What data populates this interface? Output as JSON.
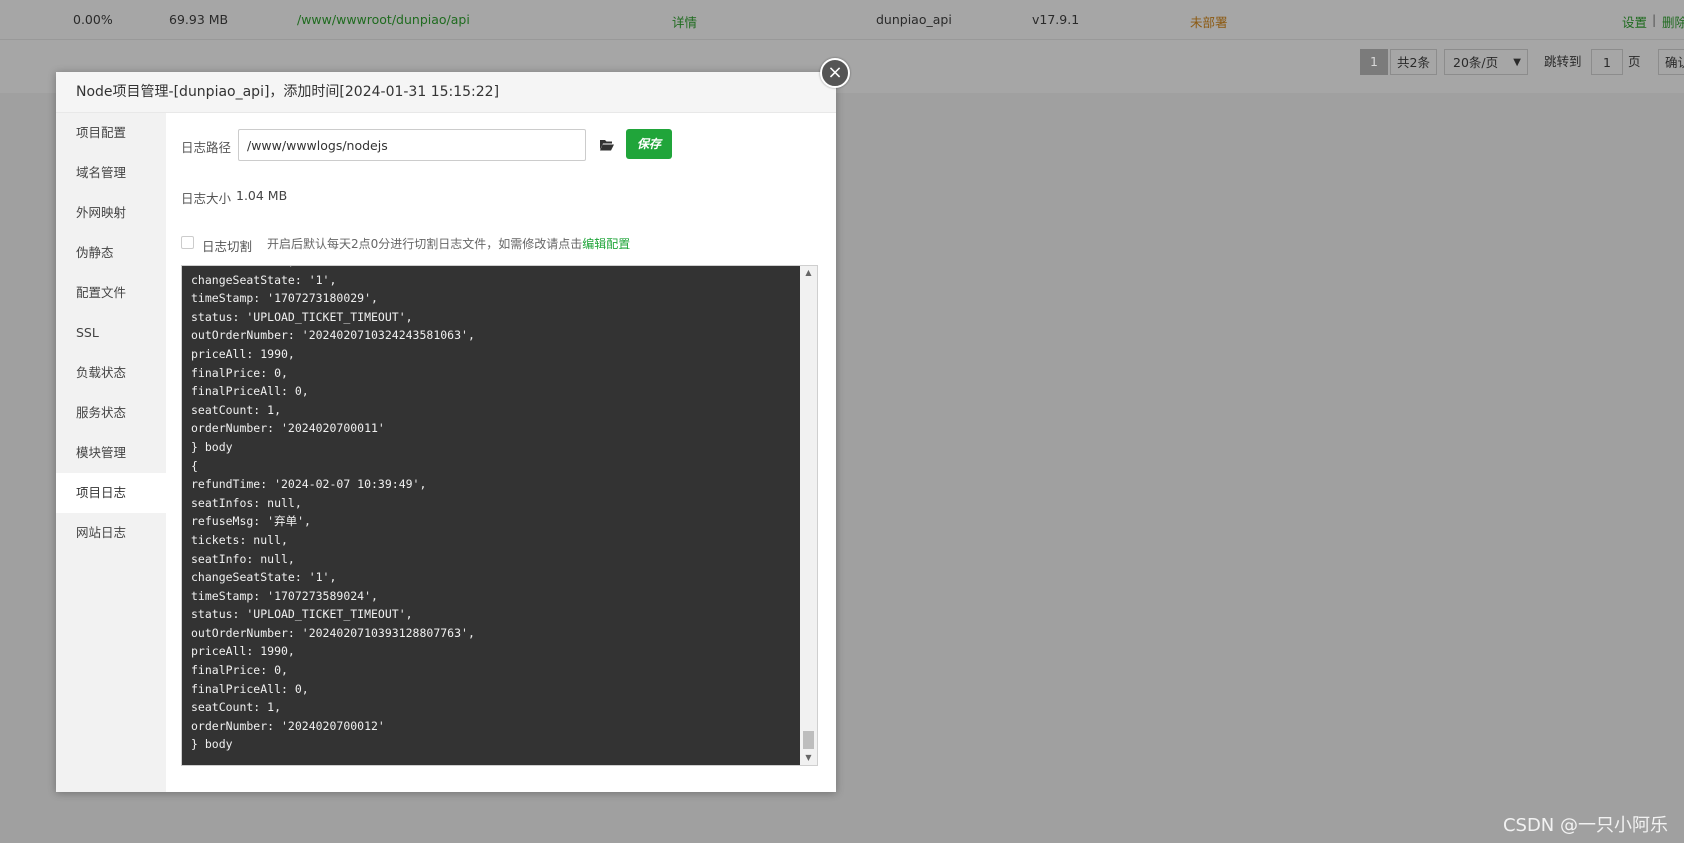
{
  "background": {
    "row": {
      "cpu": "0.00%",
      "memory": "69.93 MB",
      "path": "/www/wwwroot/dunpiao/api",
      "details": "详情",
      "name": "dunpiao_api",
      "node_version": "v17.9.1",
      "status": "未部署",
      "settings": "设置",
      "separator": "|",
      "delete": "删除"
    },
    "pager": {
      "current_page": "1",
      "total": "共2条",
      "per_page": "20条/页",
      "jump_to": "跳转到",
      "jump_value": "1",
      "page_unit": "页",
      "confirm": "确认"
    }
  },
  "modal": {
    "title": "Node项目管理-[dunpiao_api]，添加时间[2024-01-31 15:15:22]",
    "close_glyph": "×",
    "sidebar": [
      {
        "label": "项目配置"
      },
      {
        "label": "域名管理"
      },
      {
        "label": "外网映射"
      },
      {
        "label": "伪静态"
      },
      {
        "label": "配置文件"
      },
      {
        "label": "SSL"
      },
      {
        "label": "负载状态"
      },
      {
        "label": "服务状态"
      },
      {
        "label": "模块管理"
      },
      {
        "label": "项目日志",
        "active": true
      },
      {
        "label": "网站日志"
      }
    ],
    "log_path_label": "日志路径",
    "log_path_value": "/www/wwwlogs/nodejs",
    "save_label": "保存",
    "log_size_label": "日志大小",
    "log_size_value": "1.04 MB",
    "cut_label": "日志切割",
    "cut_hint": "开启后默认每天2点0分进行切割日志文件，如需修改请点击",
    "cut_link": "编辑配置",
    "log_lines": [
      "seatInfo: null,",
      "changeSeatState: '1',",
      "timeStamp: '1707273180029',",
      "status: 'UPLOAD_TICKET_TIMEOUT',",
      "outOrderNumber: '2024020710324243581063',",
      "priceAll: 1990,",
      "finalPrice: 0,",
      "finalPriceAll: 0,",
      "seatCount: 1,",
      "orderNumber: '2024020700011'",
      "} body",
      "{",
      "refundTime: '2024-02-07 10:39:49',",
      "seatInfos: null,",
      "refuseMsg: '弃单',",
      "tickets: null,",
      "seatInfo: null,",
      "changeSeatState: '1',",
      "timeStamp: '1707273589024',",
      "status: 'UPLOAD_TICKET_TIMEOUT',",
      "outOrderNumber: '2024020710393128807763',",
      "priceAll: 1990,",
      "finalPrice: 0,",
      "finalPriceAll: 0,",
      "seatCount: 1,",
      "orderNumber: '2024020700012'",
      "} body"
    ]
  },
  "watermark": "CSDN @一只小阿乐",
  "colors": {
    "accent": "#20a53a",
    "log_bg": "#333333",
    "overlay": "#a0a0a0"
  }
}
